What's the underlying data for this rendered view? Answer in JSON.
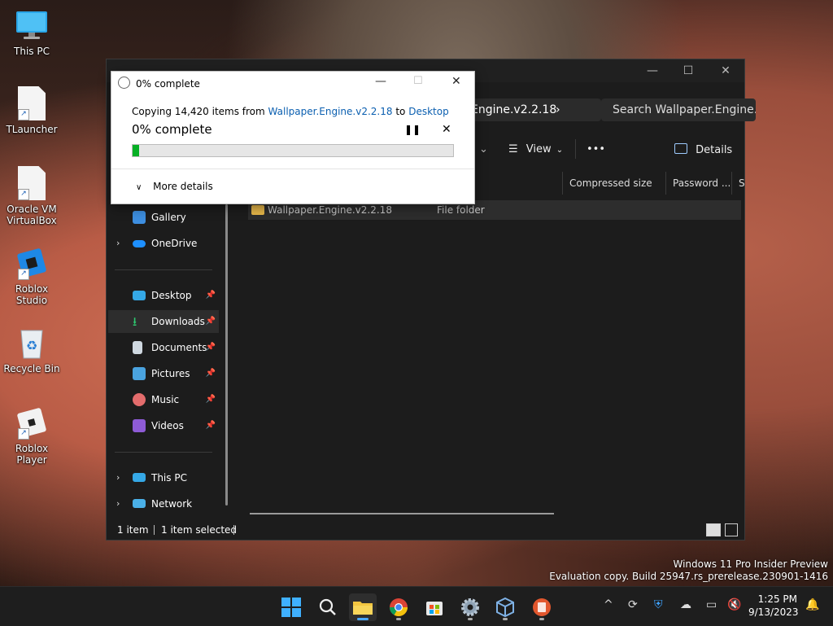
{
  "desktop": {
    "icons": [
      {
        "label": "This PC"
      },
      {
        "label": "TLauncher"
      },
      {
        "label": "Oracle VM VirtualBox"
      },
      {
        "label": "Roblox Studio"
      },
      {
        "label": "Recycle Bin"
      },
      {
        "label": "Roblox Player"
      }
    ],
    "watermark_line1": "Windows 11 Pro Insider Preview",
    "watermark_line2": "Evaluation copy. Build 25947.rs_prerelease.230901-1416"
  },
  "explorer": {
    "address_text": "Engine.v2.2.18",
    "search_placeholder": "Search Wallpaper.Engine.v",
    "toolbar": {
      "view_label": "View",
      "more_label": "•••",
      "details_label": "Details"
    },
    "columns": [
      "Compressed size",
      "Password ...",
      "Si"
    ],
    "nav": {
      "gallery": "Gallery",
      "onedrive": "OneDrive",
      "desktop": "Desktop",
      "downloads": "Downloads",
      "documents": "Documents",
      "pictures": "Pictures",
      "music": "Music",
      "videos": "Videos",
      "this_pc": "This PC",
      "network": "Network"
    },
    "files": [
      {
        "name": "Wallpaper.Engine.v2.2.18",
        "type": "File folder"
      }
    ],
    "status": {
      "count": "1 item",
      "selected": "1 item selected"
    }
  },
  "copy_dialog": {
    "title": "0% complete",
    "copying_prefix": "Copying 14,420 items from",
    "source": "Wallpaper.Engine.v2.2.18",
    "to_word": "to",
    "destination": "Desktop",
    "percent_label": "0% complete",
    "progress_percent": 2,
    "more_details": "More details"
  },
  "taskbar": {
    "time": "1:25 PM",
    "date": "9/13/2023"
  },
  "colors": {
    "accent": "#0b5fb0",
    "progress": "#06b025",
    "explorer_bg": "#1c1c1c",
    "taskbar_bg": "#1e1e1e"
  }
}
